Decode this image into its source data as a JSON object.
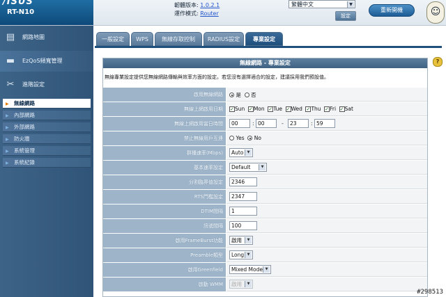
{
  "header": {
    "brand": "/ISUS",
    "model": "RT-N10",
    "firmware_label": "韌體版本:",
    "firmware_value": "1.0.2.1",
    "mode_label": "運作模式:",
    "mode_value": "Router",
    "language": "繁體中文",
    "apply_lang_label": "設定",
    "restart_label": "重新開機"
  },
  "sidebar": {
    "big_items": [
      {
        "label": "網路地圖"
      },
      {
        "label": "EzQoS頻寬管理"
      },
      {
        "label": "進階設定"
      }
    ],
    "sub_items": [
      {
        "label": "無線網路"
      },
      {
        "label": "內部網路"
      },
      {
        "label": "外部網路"
      },
      {
        "label": "防火牆"
      },
      {
        "label": "系統管理"
      },
      {
        "label": "系統紀錄"
      }
    ]
  },
  "tabs": [
    {
      "label": "一般設定"
    },
    {
      "label": "WPS"
    },
    {
      "label": "無線存取控制"
    },
    {
      "label": "RADIUS設定"
    },
    {
      "label": "專業設定"
    }
  ],
  "panel": {
    "title": "無線網路 - 專業設定",
    "description": "無線專業設定提供您無線網路傳輸與效率方面的設定。若您沒有選擇適合的設定，建議採用我們預設值。",
    "rows": {
      "enable_radio": {
        "label": "啟用無線網路",
        "opt_yes": "是",
        "opt_no": "否"
      },
      "days": {
        "label": "無線上網啟用日期",
        "days": [
          "Sun",
          "Mon",
          "Tue",
          "Wed",
          "Thu",
          "Fri",
          "Sat"
        ]
      },
      "time": {
        "label": "無線上網啟用當日時間",
        "h1": "00",
        "m1": "00",
        "h2": "23",
        "m2": "59"
      },
      "isolation": {
        "label": "禁止無線用戶互連",
        "opt_yes": "Yes",
        "opt_no": "No"
      },
      "multicast": {
        "label": "群播速率(Mbps)",
        "value": "Auto"
      },
      "basic_rate": {
        "label": "基本速率設定",
        "value": "Default"
      },
      "frag": {
        "label": "分割臨界值設定",
        "value": "2346"
      },
      "rts": {
        "label": "RTS門檻設定",
        "value": "2347"
      },
      "dtim": {
        "label": "DTIM間隔",
        "value": "1"
      },
      "beacon": {
        "label": "訊號間隔",
        "value": "100"
      },
      "frameburst": {
        "label": "啟用FrameBurst功能",
        "value": "啟用"
      },
      "preamble": {
        "label": "Preamble類型",
        "value": "Long"
      },
      "greenfield": {
        "label": "啟用Greenfield",
        "value": "Mixed Mode"
      },
      "wmm": {
        "label": "啟動 WMM",
        "value": "啟用"
      }
    }
  },
  "watermark": "#298513"
}
